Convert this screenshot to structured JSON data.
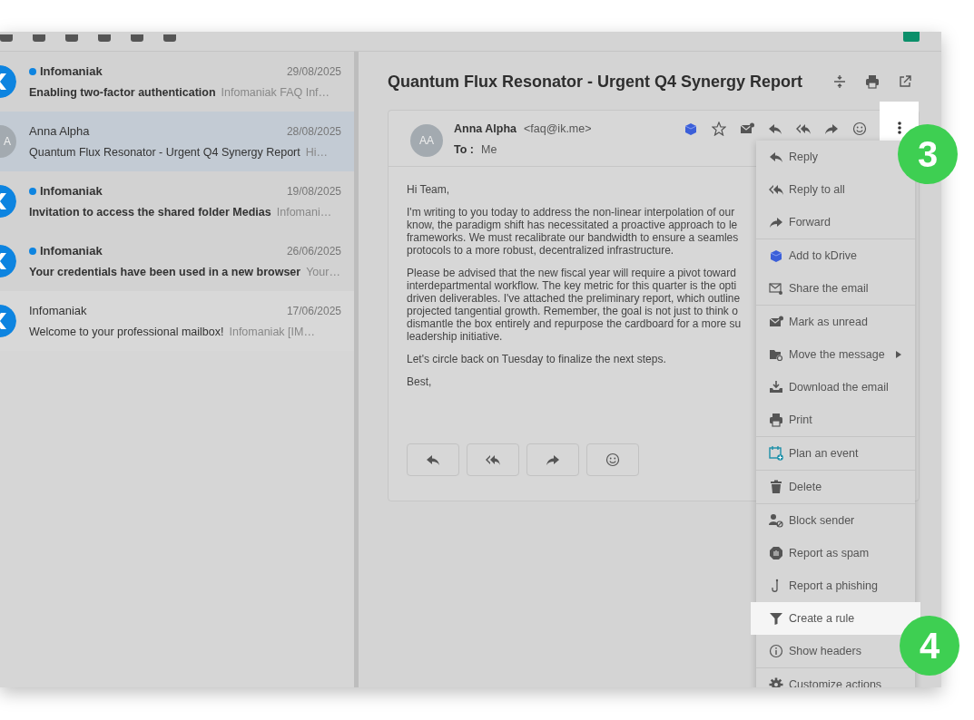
{
  "mail_list": [
    {
      "sender": "Infomaniak",
      "unread": true,
      "date": "29/08/2025",
      "subject": "Enabling two-factor authentication",
      "preview": "Infomaniak  FAQ Inf…",
      "selected": false
    },
    {
      "sender": "Anna Alpha",
      "unread": false,
      "date": "28/08/2025",
      "subject": "Quantum Flux Resonator - Urgent Q4 Synergy Report",
      "preview": "Hi…",
      "initials": "A",
      "selected": true
    },
    {
      "sender": "Infomaniak",
      "unread": true,
      "date": "19/08/2025",
      "subject": "Invitation to access the shared folder Medias",
      "preview": "Infomani…",
      "selected": false
    },
    {
      "sender": "Infomaniak",
      "unread": true,
      "date": "26/06/2025",
      "subject": "Your credentials have been used in a new browser",
      "preview": "Your…",
      "selected": false
    },
    {
      "sender": "Infomaniak",
      "unread": false,
      "date": "17/06/2025",
      "subject": "Welcome to your professional mailbox!",
      "preview": "Infomaniak  [IM…",
      "selected": false
    }
  ],
  "message": {
    "subject": "Quantum Flux Resonator - Urgent Q4 Synergy Report",
    "avatar_initials": "AA",
    "from_name": "Anna Alpha",
    "from_email": "<faq@ik.me>",
    "to_label": "To :",
    "to": "Me",
    "more_button": {
      "highlighted": true
    },
    "greeting": "Hi Team,",
    "paragraphs": [
      [
        "I'm writing to you today to address the non-linear interpolation of our",
        "know, the paradigm shift has necessitated a proactive approach to le",
        "frameworks. We must recalibrate our bandwidth to ensure a seamles",
        "protocols to a more robust, decentralized infrastructure."
      ],
      [
        "Please be advised that the new fiscal year will require a pivot toward",
        "interdepartmental workflow. The key metric for this quarter is the opti",
        "driven deliverables. I've attached the preliminary report, which outline",
        "projected tangential growth. Remember, the goal is not just to think o",
        "dismantle the box entirely and repurpose the cardboard for a more su",
        "leadership initiative."
      ],
      [
        "Let's circle back on Tuesday to finalize the next steps."
      ],
      [
        "Best,"
      ]
    ]
  },
  "menu": {
    "groups": [
      [
        {
          "label": "Reply",
          "submenu": false,
          "highlighted": false
        },
        {
          "label": "Reply to all",
          "submenu": false,
          "highlighted": false
        },
        {
          "label": "Forward",
          "submenu": false,
          "highlighted": false
        }
      ],
      [
        {
          "label": "Add to kDrive",
          "submenu": false,
          "highlighted": false
        },
        {
          "label": "Share the email",
          "submenu": false,
          "highlighted": false
        }
      ],
      [
        {
          "label": "Mark as unread",
          "submenu": false,
          "highlighted": false
        },
        {
          "label": "Move the message",
          "submenu": true,
          "highlighted": false
        },
        {
          "label": "Download the email",
          "submenu": false,
          "highlighted": false
        },
        {
          "label": "Print",
          "submenu": false,
          "highlighted": false
        }
      ],
      [
        {
          "label": "Plan an event",
          "submenu": false,
          "highlighted": false
        }
      ],
      [
        {
          "label": "Delete",
          "submenu": false,
          "highlighted": false
        }
      ],
      [
        {
          "label": "Block sender",
          "submenu": false,
          "highlighted": false
        },
        {
          "label": "Report as spam",
          "submenu": false,
          "highlighted": false
        },
        {
          "label": "Report a phishing",
          "submenu": false,
          "highlighted": false
        },
        {
          "label": "Create a rule",
          "submenu": false,
          "highlighted": true
        },
        {
          "label": "Show headers",
          "submenu": false,
          "highlighted": false
        }
      ],
      [
        {
          "label": "Customize actions",
          "submenu": false,
          "highlighted": false
        }
      ]
    ]
  },
  "callouts": [
    {
      "number": "3"
    },
    {
      "number": "4"
    }
  ]
}
